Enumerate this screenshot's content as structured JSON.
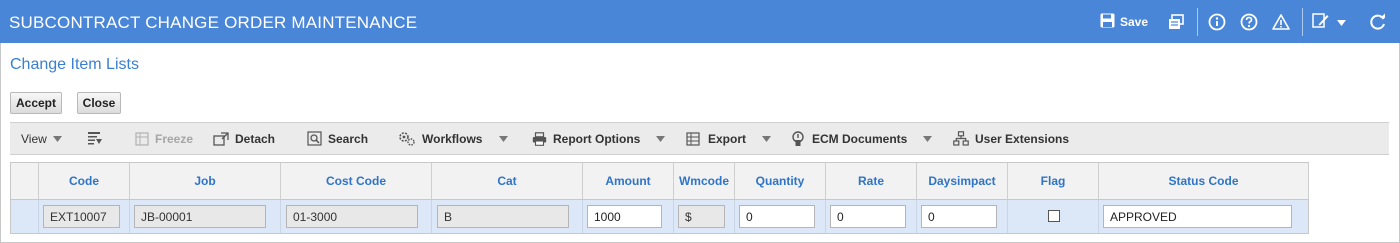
{
  "app": {
    "title": "SUBCONTRACT CHANGE ORDER MAINTENANCE",
    "save_label": "Save"
  },
  "section": {
    "title": "Change Item Lists"
  },
  "buttons": {
    "accept": "Accept",
    "close": "Close"
  },
  "toolbar": {
    "view": "View",
    "freeze": "Freeze",
    "detach": "Detach",
    "search": "Search",
    "workflows": "Workflows",
    "report_options": "Report Options",
    "export": "Export",
    "ecm_documents": "ECM Documents",
    "user_extensions": "User Extensions"
  },
  "grid": {
    "columns": [
      "Code",
      "Job",
      "Cost Code",
      "Cat",
      "Amount",
      "Wmcode",
      "Quantity",
      "Rate",
      "Daysimpact",
      "Flag",
      "Status Code"
    ],
    "row": {
      "code": "EXT10007",
      "job": "JB-00001",
      "cost_code": "01-3000",
      "cat": "B",
      "amount": "1000",
      "wmcode": "$",
      "quantity": "0",
      "rate": "0",
      "daysimpact": "0",
      "flag": false,
      "status_code": "APPROVED"
    }
  },
  "colors": {
    "titlebar": "#4a86d8",
    "header_text": "#2f74c6",
    "row_bg": "#dce8f7"
  }
}
